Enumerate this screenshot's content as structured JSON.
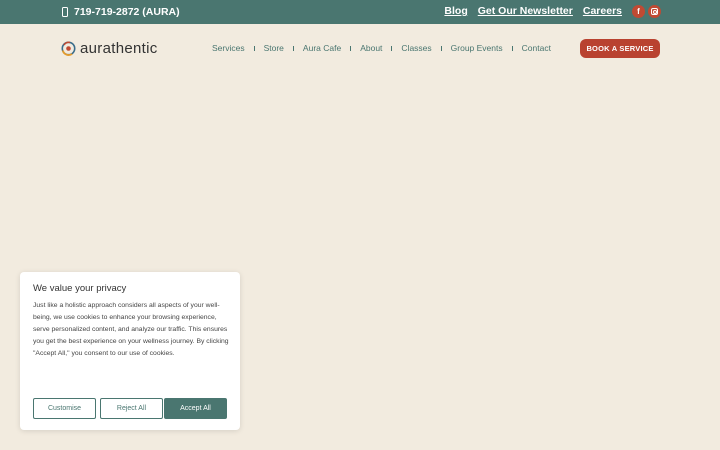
{
  "topbar": {
    "phone": "719-719-2872 (AURA)",
    "links": [
      "Blog",
      "Get Our Newsletter",
      "Careers"
    ],
    "social": [
      "facebook-icon",
      "instagram-icon"
    ],
    "social_text": {
      "facebook": "f"
    }
  },
  "header": {
    "logo": "aurathentic",
    "nav": [
      "Services",
      "Store",
      "Aura Cafe",
      "About",
      "Classes",
      "Group Events",
      "Contact"
    ],
    "cta": "BOOK A SERVICE"
  },
  "cookie": {
    "title": "We value your privacy",
    "body": "Just like a holistic approach considers all aspects of your well-being, we use cookies to enhance your browsing experience, serve personalized content, and analyze our traffic. This ensures you get the best experience on your wellness journey. By clicking \"Accept All,\" you consent to our use of cookies.",
    "buttons": {
      "customise": "Customise",
      "reject": "Reject All",
      "accept": "Accept All"
    }
  },
  "colors": {
    "teal": "#4a7670",
    "accent": "#b94230",
    "background": "#f2ebdf"
  }
}
